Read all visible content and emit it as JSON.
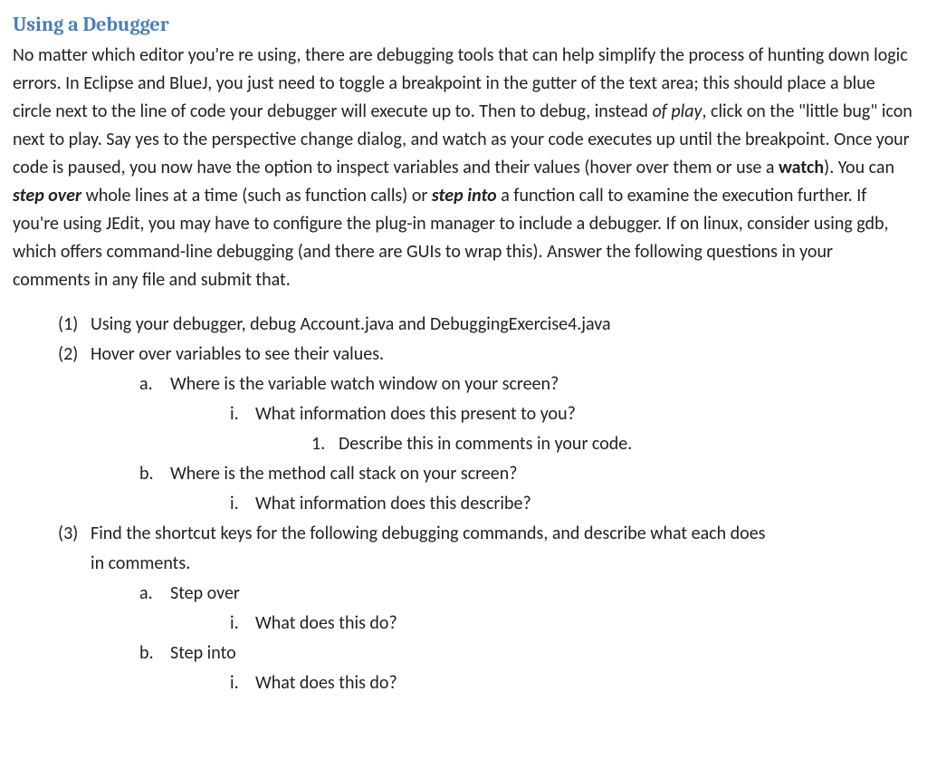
{
  "heading": "Using a Debugger",
  "paragraph": {
    "p1": "No matter which editor you're re using, there are debugging tools that can help simplify the process of hunting down logic errors.  In Eclipse and BlueJ, you just need to toggle a breakpoint in the gutter of the text area; this should place a blue circle next to the line of code your debugger will execute up to.  Then to debug, instead ",
    "p2_italic": "of play",
    "p3": ", click on the \"little bug\" icon next to play.  Say yes to the perspective change dialog, and watch as your code executes up until the breakpoint.  Once your code is paused, you now have the option to inspect variables and their values (hover over them or use a ",
    "p4_bold": "watch",
    "p5": ").  You can ",
    "p6_bi": "step over",
    "p7": " whole lines at a time (such as function calls) or ",
    "p8_bi": "step into",
    "p9": " a function call to examine the execution further.  If you're using JEdit, you may have to configure the plug-in manager to include a debugger.  If on linux, consider using gdb, which offers command-line debugging (and there are GUIs to wrap this).  Answer the following questions in your comments in any file and submit that."
  },
  "list": {
    "q1": {
      "marker": "(1)",
      "text": "Using your debugger, debug Account.java and DebuggingExercise4.java"
    },
    "q2": {
      "marker": "(2)",
      "text": "Hover over variables to see their values."
    },
    "q2a": {
      "marker": "a.",
      "text": "Where is the variable watch window on your screen?"
    },
    "q2a_i": {
      "marker": "i.",
      "text": "What information does this present to you?"
    },
    "q2a_i_1": {
      "marker": "1.",
      "text": "Describe this in comments in your code."
    },
    "q2b": {
      "marker": "b.",
      "text": "Where is the method call stack on your screen?"
    },
    "q2b_i": {
      "marker": "i.",
      "text": "What information does this describe?"
    },
    "q3": {
      "marker": "(3)",
      "text": "Find the shortcut keys for the following debugging commands, and describe what each does"
    },
    "q3_cont": "in comments.",
    "q3a": {
      "marker": "a.",
      "text": "Step over"
    },
    "q3a_i": {
      "marker": "i.",
      "text": "What does this do?"
    },
    "q3b": {
      "marker": "b.",
      "text": "Step into"
    },
    "q3b_i": {
      "marker": "i.",
      "text": "What does this do?"
    }
  }
}
